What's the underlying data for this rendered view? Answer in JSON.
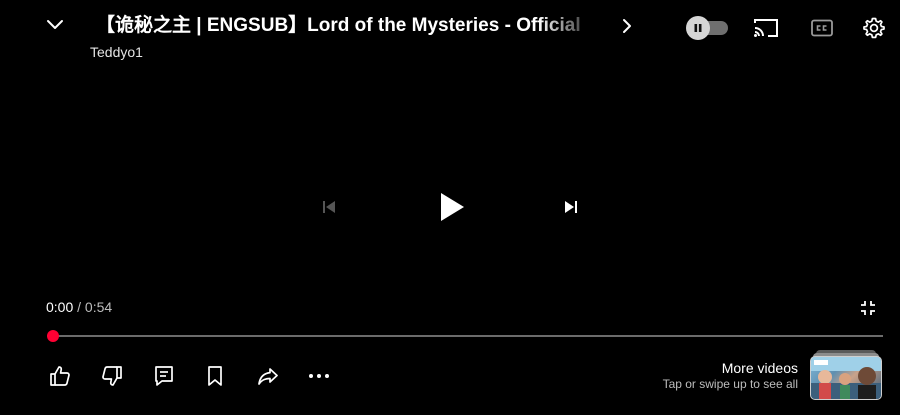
{
  "header": {
    "title": "【诡秘之主 | ENGSUB】Lord of the Mysteries - Official",
    "channel": "Teddyo1"
  },
  "icons": {
    "collapse": "chevron-down-icon",
    "title_expand": "chevron-right-icon",
    "autoplay": "pause-icon",
    "cast": "cast-icon",
    "captions": "closed-captions-icon",
    "settings": "gear-icon",
    "previous": "skip-previous-icon",
    "play": "play-icon",
    "next": "skip-next-icon",
    "exit_fullscreen": "exit-fullscreen-icon",
    "like": "thumbs-up-icon",
    "dislike": "thumbs-down-icon",
    "comments": "comments-icon",
    "save": "bookmark-icon",
    "share": "share-icon",
    "more": "more-horizontal-icon"
  },
  "player": {
    "current_time": "0:00",
    "separator": "/",
    "duration": "0:54",
    "progress": 0,
    "autoplay_on": false
  },
  "more_videos": {
    "title": "More videos",
    "subtitle": "Tap or swipe up to see all"
  },
  "colors": {
    "background": "#000000",
    "accent": "#ff0033",
    "track": "#6b6b6b"
  }
}
